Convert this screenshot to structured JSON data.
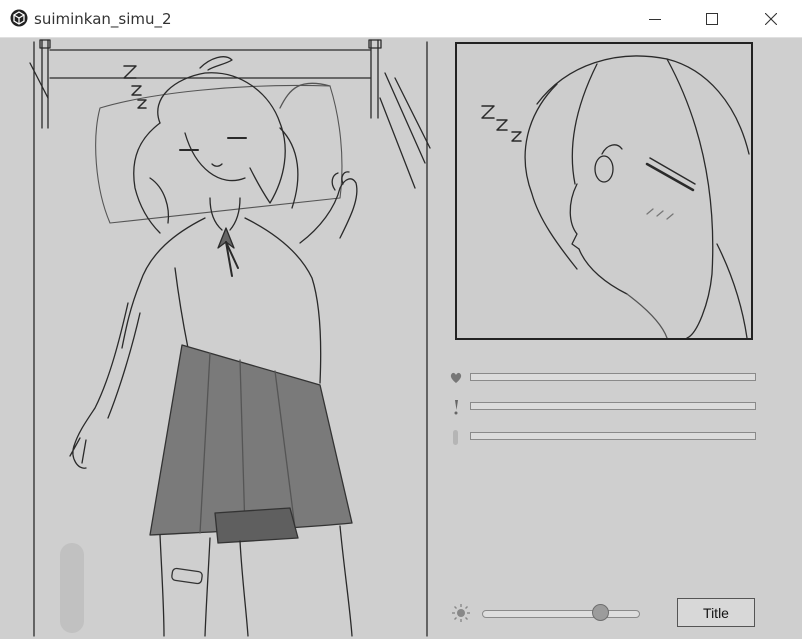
{
  "window": {
    "title": "suiminkan_simu_2",
    "controls": [
      "minimize",
      "maximize",
      "close"
    ]
  },
  "scene": {
    "bed_scene_zzz": "Z Z Z",
    "closeup_zzz": "Z Z Z"
  },
  "status_bars": [
    {
      "icon": "heart-icon",
      "level": 0
    },
    {
      "icon": "exclamation-icon",
      "level": 0
    },
    {
      "icon": "figure-icon",
      "level": 0
    }
  ],
  "brightness": {
    "icon": "sun-icon",
    "level": 0.76
  },
  "buttons": {
    "title_label": "Title"
  },
  "colors": {
    "background": "#cfcfcf",
    "line": "#222222",
    "skirt": "#7a7a7a"
  }
}
